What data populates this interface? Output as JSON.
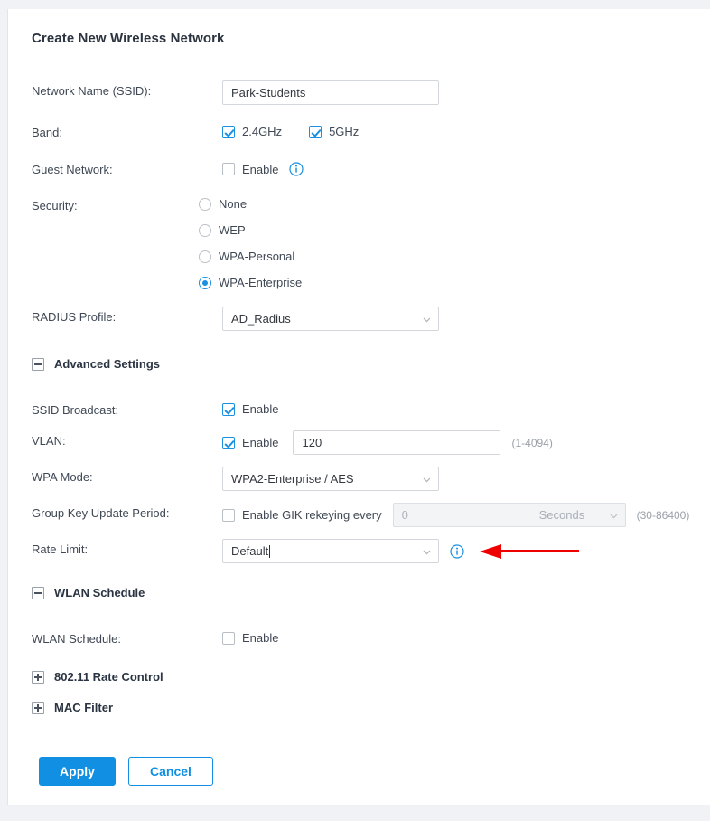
{
  "form": {
    "title": "Create New Wireless Network",
    "ssid": {
      "label": "Network Name (SSID):",
      "value": "Park-Students",
      "placeholder": ""
    },
    "band": {
      "label": "Band:",
      "options": [
        {
          "label": "2.4GHz",
          "checked": true
        },
        {
          "label": "5GHz",
          "checked": true
        }
      ]
    },
    "guest_network": {
      "label": "Guest Network:",
      "enable_label": "Enable",
      "checked": false,
      "info_icon": "info-icon"
    },
    "security": {
      "label": "Security:",
      "options": [
        {
          "label": "None",
          "selected": false
        },
        {
          "label": "WEP",
          "selected": false
        },
        {
          "label": "WPA-Personal",
          "selected": false
        },
        {
          "label": "WPA-Enterprise",
          "selected": true
        }
      ]
    },
    "radius_profile": {
      "label": "RADIUS Profile:",
      "value": "AD_Radius",
      "chevron_icon": "chevron-down-icon"
    }
  },
  "advanced": {
    "section_label": "Advanced Settings",
    "toggle_state": "expanded",
    "toggle_icon": "minus-icon",
    "ssid_broadcast": {
      "label": "SSID Broadcast:",
      "enable_label": "Enable",
      "checked": true
    },
    "vlan": {
      "label": "VLAN:",
      "enable_label": "Enable",
      "checked": true,
      "value": "120",
      "hint": "(1-4094)"
    },
    "wpa_mode": {
      "label": "WPA Mode:",
      "value": "WPA2-Enterprise / AES",
      "chevron_icon": "chevron-down-icon"
    },
    "group_key": {
      "label": "Group Key Update Period:",
      "enable_label": "Enable GIK rekeying every",
      "checked": false,
      "value": "0",
      "unit": "Seconds",
      "hint": "(30-86400)",
      "chevron_icon": "chevron-down-icon"
    },
    "rate_limit": {
      "label": "Rate Limit:",
      "value": "Default",
      "chevron_icon": "chevron-down-icon",
      "info_icon": "info-icon",
      "focused": true
    }
  },
  "wlan_schedule": {
    "section_label": "WLAN Schedule",
    "toggle_state": "expanded",
    "toggle_icon": "minus-icon",
    "row": {
      "label": "WLAN Schedule:",
      "enable_label": "Enable",
      "checked": false
    }
  },
  "collapsed_sections": [
    {
      "label": "802.11 Rate Control",
      "toggle_state": "collapsed",
      "toggle_icon": "plus-icon"
    },
    {
      "label": "MAC Filter",
      "toggle_state": "collapsed",
      "toggle_icon": "plus-icon"
    }
  ],
  "actions": {
    "apply_label": "Apply",
    "cancel_label": "Cancel"
  },
  "annotation": {
    "type": "arrow",
    "direction": "left",
    "color": "#ee0000",
    "points_at": "rate-limit-info-icon"
  },
  "colors": {
    "accent": "#1190e3",
    "page_background": "#f0f2f5",
    "card_background": "#ffffff",
    "text": "#3f4854",
    "hint_text": "#9aa0a8",
    "annotation_red": "#ee0000"
  }
}
